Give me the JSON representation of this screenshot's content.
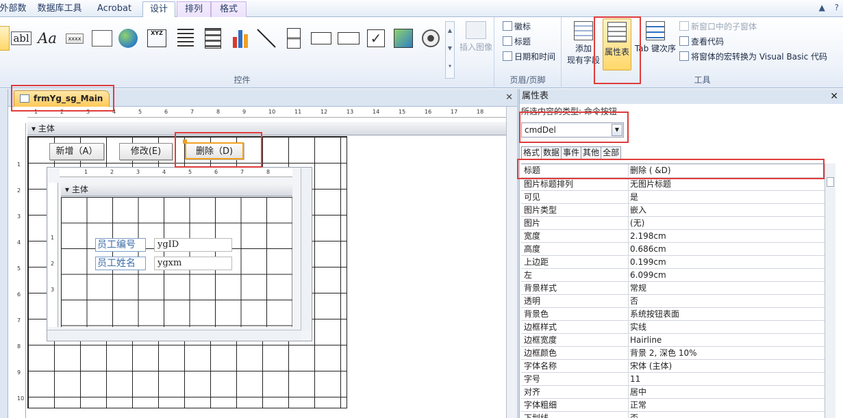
{
  "tabs": [
    "外部数据",
    "数据库工具",
    "Acrobat",
    "设计",
    "排列",
    "格式"
  ],
  "tabbar_icons": [
    "▲",
    "?"
  ],
  "ribbon": {
    "controls_group_label": "控件",
    "insert_image_label": "插入图像",
    "header_footer_items": [
      "徽标",
      "标题",
      "日期和时间"
    ],
    "header_footer_label": "页眉/页脚",
    "add_field_label_1": "添加",
    "add_field_label_2": "现有字段",
    "property_sheet_label": "属性表",
    "tab_order_label": "Tab 键次序",
    "tools_items": [
      "新窗口中的子窗体",
      "查看代码",
      "将窗体的宏转换为 Visual Basic 代码"
    ],
    "tools_label": "工具",
    "textbox_glyph": "abl",
    "label_glyph": "Aa",
    "button_glyph": "xxxx",
    "xyz_glyph": "XYZ"
  },
  "document": {
    "tab_name": "frmYg_sg_Main",
    "section_label": "主体",
    "buttons": [
      "新增（A）",
      "修改(E)",
      "删除（D)"
    ],
    "subform": {
      "section_label": "主体",
      "labels": [
        "员工编号",
        "员工姓名"
      ],
      "fields": [
        "ygID",
        "ygxm"
      ]
    },
    "ruler_numbers": [
      "1",
      "2",
      "3",
      "4",
      "5",
      "6",
      "7",
      "8",
      "9",
      "10",
      "11",
      "12",
      "13",
      "14",
      "15",
      "16",
      "17",
      "18"
    ],
    "vruler_numbers": [
      "1",
      "2",
      "3",
      "4",
      "5",
      "6",
      "7",
      "8",
      "9",
      "10"
    ],
    "sub_ruler_numbers": [
      "1",
      "2",
      "3",
      "4",
      "5",
      "6",
      "7",
      "8"
    ],
    "sub_vruler_numbers": [
      "1",
      "2",
      "3"
    ]
  },
  "property_sheet": {
    "title": "属性表",
    "subtitle": "所选内容的类型: 命令按钮",
    "selected_object": "cmdDel",
    "tabs": [
      "格式",
      "数据",
      "事件",
      "其他",
      "全部"
    ],
    "rows": [
      {
        "k": "标题",
        "v": "删除 ( &D)"
      },
      {
        "k": "图片标题排列",
        "v": "无图片标题"
      },
      {
        "k": "可见",
        "v": "是"
      },
      {
        "k": "图片类型",
        "v": "嵌入"
      },
      {
        "k": "图片",
        "v": "(无)"
      },
      {
        "k": "宽度",
        "v": "2.198cm"
      },
      {
        "k": "高度",
        "v": "0.686cm"
      },
      {
        "k": "上边距",
        "v": "0.199cm"
      },
      {
        "k": "左",
        "v": "6.099cm"
      },
      {
        "k": "背景样式",
        "v": "常规"
      },
      {
        "k": "透明",
        "v": "否"
      },
      {
        "k": "背景色",
        "v": "系统按钮表面"
      },
      {
        "k": "边框样式",
        "v": "实线"
      },
      {
        "k": "边框宽度",
        "v": "Hairline"
      },
      {
        "k": "边框颜色",
        "v": "背景 2, 深色 10%"
      },
      {
        "k": "字体名称",
        "v": "宋体 (主体)"
      },
      {
        "k": "字号",
        "v": "11"
      },
      {
        "k": "对齐",
        "v": "居中"
      },
      {
        "k": "字体粗细",
        "v": "正常"
      },
      {
        "k": "下划线",
        "v": "否"
      }
    ]
  },
  "colors": {
    "annotation": "#e03b3b",
    "selection": "#f0a020",
    "ribbon_active": "#ffd86a"
  }
}
